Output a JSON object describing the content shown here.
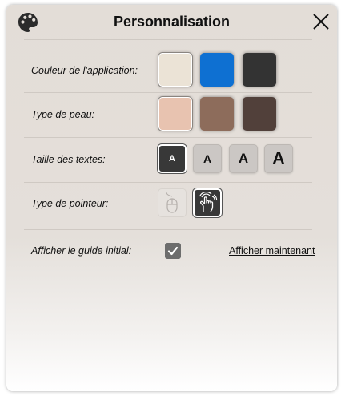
{
  "dialog": {
    "title": "Personnalisation",
    "icons": {
      "title": "palette-icon",
      "close": "close-icon"
    }
  },
  "app_color": {
    "label": "Couleur de l'application:",
    "options": [
      {
        "color": "#ebe3d6",
        "selected": true
      },
      {
        "color": "#0e70d2",
        "selected": false
      },
      {
        "color": "#333333",
        "selected": false
      }
    ]
  },
  "skin": {
    "label": "Type de peau:",
    "options": [
      {
        "color": "#e8c3b0",
        "selected": true
      },
      {
        "color": "#8d6c5b",
        "selected": false
      },
      {
        "color": "#51403a",
        "selected": false
      }
    ]
  },
  "text_size": {
    "label": "Taille des textes:",
    "options": [
      {
        "glyph": "A",
        "selected": true
      },
      {
        "glyph": "A",
        "selected": false
      },
      {
        "glyph": "A",
        "selected": false
      },
      {
        "glyph": "A",
        "selected": false
      }
    ]
  },
  "pointer": {
    "label": "Type de pointeur:",
    "options": [
      {
        "icon": "mouse-icon",
        "selected": false
      },
      {
        "icon": "touch-gesture-icon",
        "selected": true
      }
    ]
  },
  "guide": {
    "label": "Afficher le guide initial:",
    "checked": true,
    "link": "Afficher maintenant"
  }
}
